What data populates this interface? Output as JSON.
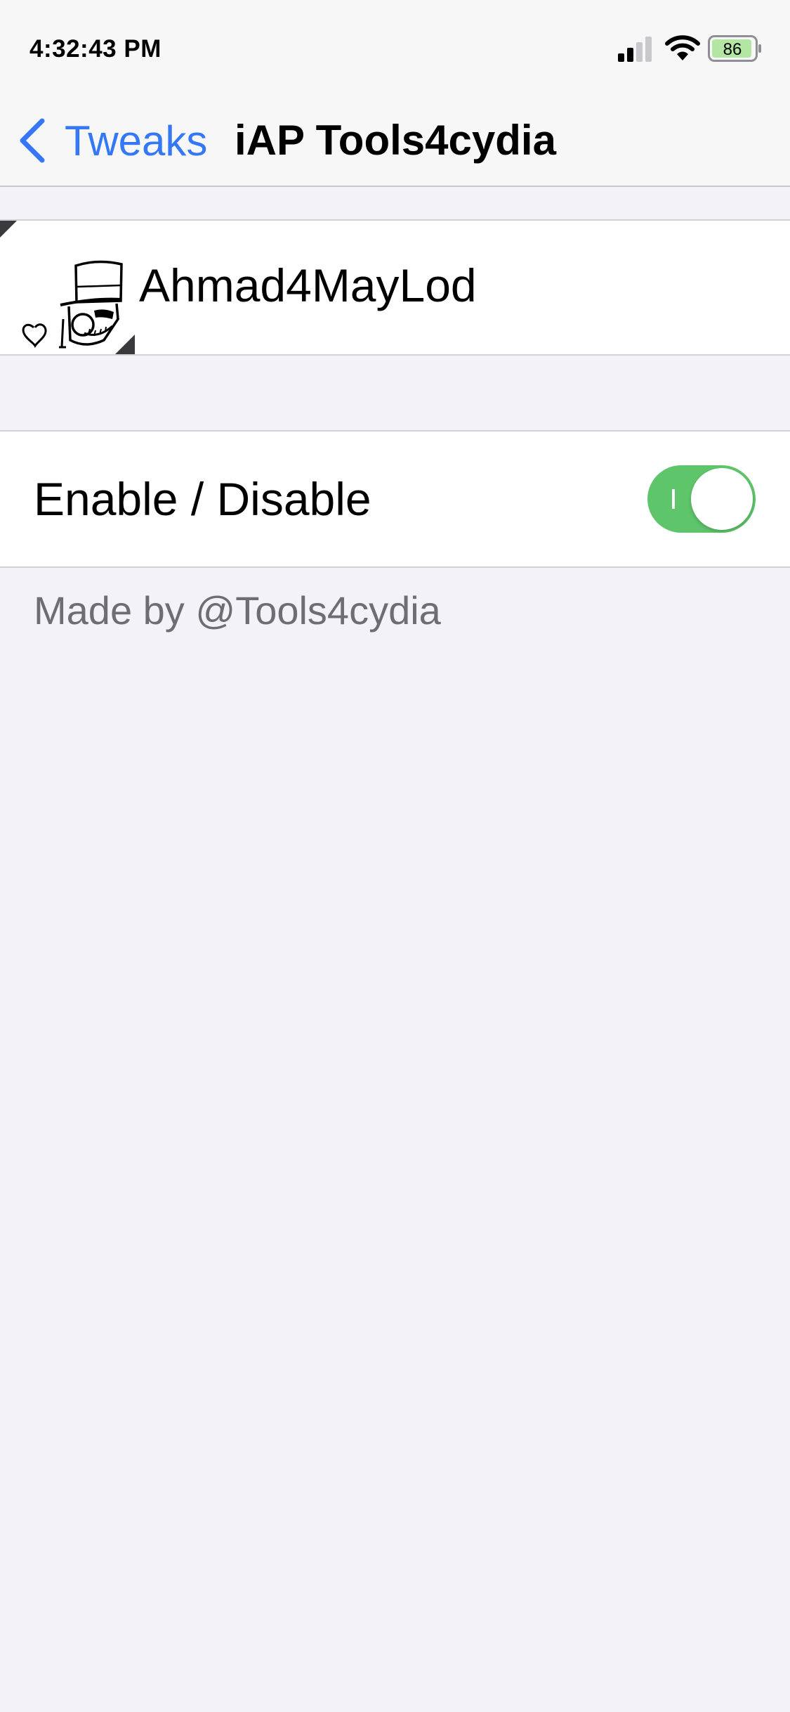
{
  "status_bar": {
    "time": "4:32:43 PM",
    "battery": "86",
    "icons": [
      "cellular-signal-icon",
      "wifi-icon",
      "battery-icon"
    ]
  },
  "nav": {
    "back_label": "Tweaks",
    "title": "iAP Tools4cydia",
    "icons": [
      "chevron-left-icon"
    ]
  },
  "header": {
    "name": "Ahmad4MayLod",
    "icons": [
      "top-hat-logo-icon",
      "heart-icon"
    ]
  },
  "settings": {
    "toggle_label": "Enable / Disable",
    "toggle_on": true,
    "footer": "Made by @Tools4cydia"
  },
  "colors": {
    "accent": "#3478f6",
    "switch_on": "#5fc56b",
    "background": "#f2f2f7",
    "cell": "#ffffff",
    "secondary_text": "#6d6d72"
  }
}
